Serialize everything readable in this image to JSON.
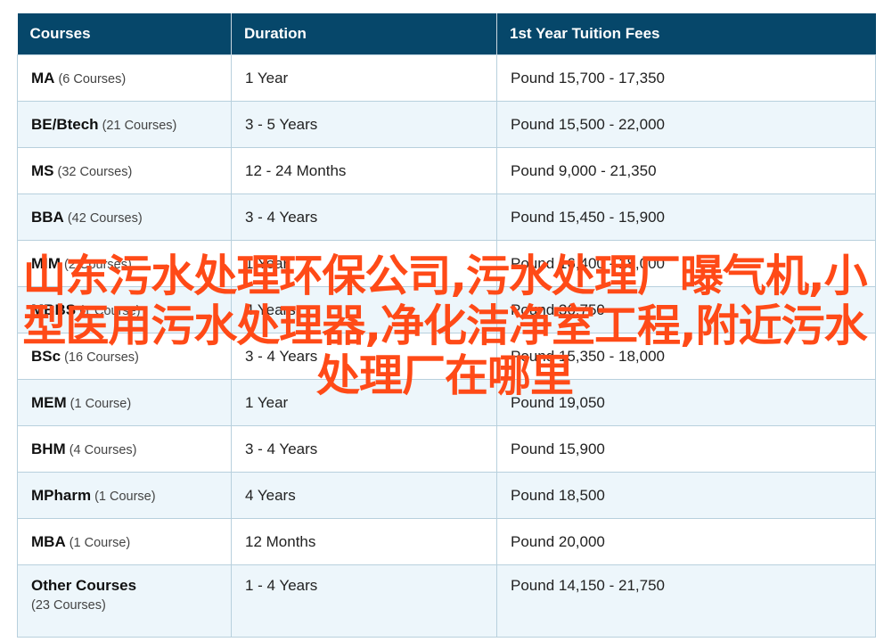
{
  "table": {
    "headers": [
      "Courses",
      "Duration",
      "1st Year Tuition Fees"
    ],
    "rows": [
      {
        "course": "MA",
        "count": "(6 Courses)",
        "duration": "1 Year",
        "fees": "Pound 15,700 - 17,350"
      },
      {
        "course": "BE/Btech",
        "count": "(21 Courses)",
        "duration": "3 - 5 Years",
        "fees": "Pound 15,500 - 22,000"
      },
      {
        "course": "MS",
        "count": "(32 Courses)",
        "duration": "12 - 24 Months",
        "fees": "Pound 9,000 - 21,350"
      },
      {
        "course": "BBA",
        "count": "(42 Courses)",
        "duration": "3 - 4 Years",
        "fees": "Pound 15,450 - 15,900"
      },
      {
        "course": "MIM",
        "count": "(2 Courses)",
        "duration": "1 Year",
        "fees": "Pound 16,400 - 18,000"
      },
      {
        "course": "MBBS",
        "count": "(1 Course)",
        "duration": "4 Years",
        "fees": "Pound 36,750"
      },
      {
        "course": "BSc",
        "count": "(16 Courses)",
        "duration": "3 - 4 Years",
        "fees": "Pound 15,350 - 18,000"
      },
      {
        "course": "MEM",
        "count": "(1 Course)",
        "duration": "1 Year",
        "fees": "Pound 19,050"
      },
      {
        "course": "BHM",
        "count": "(4 Courses)",
        "duration": "3 - 4 Years",
        "fees": "Pound 15,900"
      },
      {
        "course": "MPharm",
        "count": "(1 Course)",
        "duration": "4 Years",
        "fees": "Pound 18,500"
      },
      {
        "course": "MBA",
        "count": "(1 Course)",
        "duration": "12 Months",
        "fees": "Pound 20,000"
      },
      {
        "course": "Other Courses",
        "count": "(23 Courses)",
        "duration": "1 - 4 Years",
        "fees": "Pound 14,150 - 21,750"
      }
    ]
  },
  "overlay_text": "山东污水处理环保公司,污水处理厂曝气机,小型医用污水处理器,净化洁净室工程,附近污水处理厂在哪里",
  "colors": {
    "header_bg": "#06476a",
    "alt_row_bg": "#edf6fb",
    "border": "#b8d0dd",
    "overlay_text": "#ff4a17"
  }
}
